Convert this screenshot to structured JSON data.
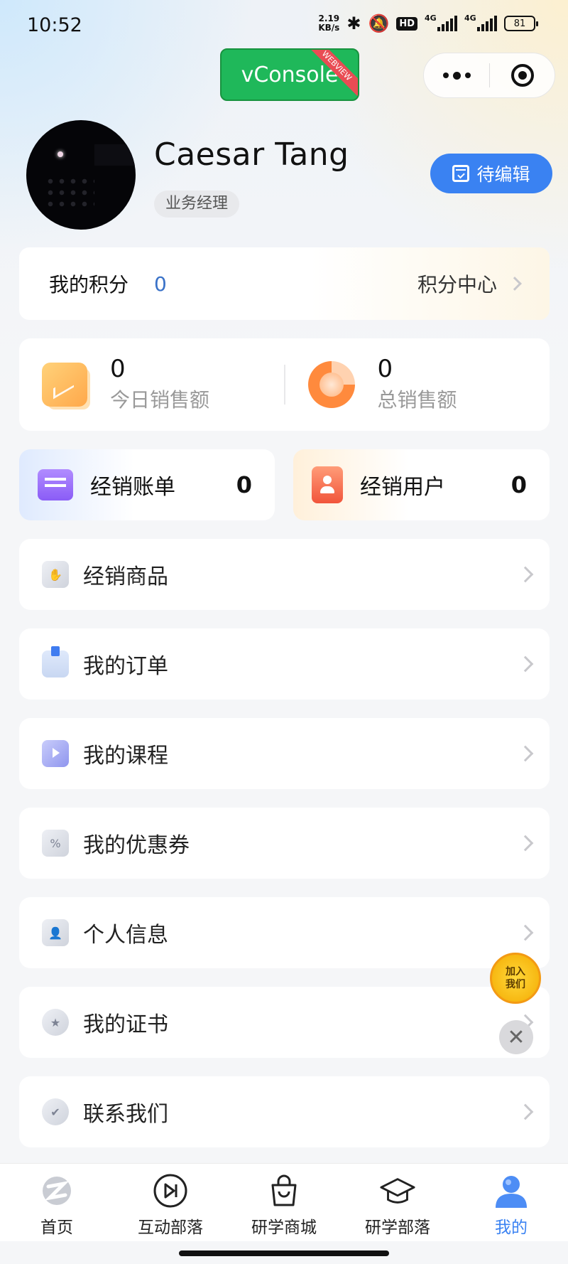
{
  "status_bar": {
    "time": "10:52",
    "net_speed_value": "2.19",
    "net_speed_unit": "KB/s",
    "hd_label": "HD",
    "signal1_label": "4G",
    "signal2_label": "4G",
    "battery": "81"
  },
  "vconsole": {
    "label": "vConsole",
    "ribbon": "WEBVIEW"
  },
  "profile": {
    "name": "Caesar Tang",
    "role": "业务经理",
    "edit_label": "待编辑"
  },
  "points": {
    "label": "我的积分",
    "value": "0",
    "center_label": "积分中心"
  },
  "sales": {
    "today": {
      "value": "0",
      "label": "今日销售额"
    },
    "total": {
      "value": "0",
      "label": "总销售额"
    }
  },
  "dealer": {
    "bills": {
      "label": "经销账单",
      "value": "0"
    },
    "users": {
      "label": "经销用户",
      "value": "0"
    }
  },
  "menu": [
    {
      "label": "经销商品",
      "icon": "product-icon"
    },
    {
      "label": "我的订单",
      "icon": "order-icon"
    },
    {
      "label": "我的课程",
      "icon": "course-icon"
    },
    {
      "label": "我的优惠券",
      "icon": "coupon-icon"
    },
    {
      "label": "个人信息",
      "icon": "profile-card-icon"
    },
    {
      "label": "我的证书",
      "icon": "medal-icon"
    },
    {
      "label": "联系我们",
      "icon": "contact-icon"
    }
  ],
  "floating": {
    "join_line1": "加入",
    "join_line2": "我们"
  },
  "tabs": [
    {
      "label": "首页",
      "icon": "home-logo-icon"
    },
    {
      "label": "互动部落",
      "icon": "play-circle-icon"
    },
    {
      "label": "研学商城",
      "icon": "shopping-bag-icon"
    },
    {
      "label": "研学部落",
      "icon": "graduation-cap-icon"
    },
    {
      "label": "我的",
      "icon": "user-icon",
      "active": true
    }
  ],
  "colors": {
    "accent": "#3a82f2",
    "vconsole_green": "#1fb85a",
    "points_value": "#3a72c8"
  }
}
